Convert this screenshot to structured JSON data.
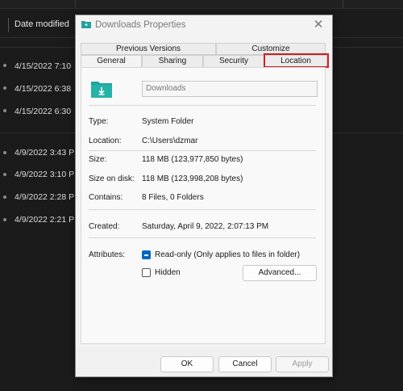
{
  "background": {
    "column_header": "Date modified",
    "rows": [
      "4/15/2022 7:10",
      "4/15/2022 6:38",
      "4/15/2022 6:30",
      "4/9/2022 3:43 P",
      "4/9/2022 3:10 P",
      "4/9/2022 2:28 P",
      "4/9/2022 2:21 P"
    ]
  },
  "dialog": {
    "title": "Downloads Properties",
    "close_glyph": "✕",
    "tabs_row1": [
      "Previous Versions",
      "Customize"
    ],
    "tabs_row2": [
      "General",
      "Sharing",
      "Security",
      "Location"
    ],
    "active_tab": "General",
    "highlighted_tab": "Location",
    "folder_name": "Downloads",
    "properties": [
      {
        "label": "Type:",
        "value": "System Folder"
      },
      {
        "label": "Location:",
        "value": "C:\\Users\\dzmar"
      },
      {
        "label": "Size:",
        "value": "118 MB (123,977,850 bytes)"
      },
      {
        "label": "Size on disk:",
        "value": "118 MB (123,998,208 bytes)"
      },
      {
        "label": "Contains:",
        "value": "8 Files, 0 Folders"
      },
      {
        "label": "Created:",
        "value": "Saturday, April 9, 2022, 2:07:13 PM"
      }
    ],
    "attributes": {
      "label": "Attributes:",
      "read_only": {
        "label": "Read-only (Only applies to files in folder)",
        "state": "indeterminate"
      },
      "hidden": {
        "label": "Hidden",
        "checked": false
      },
      "advanced_button": "Advanced..."
    },
    "buttons": {
      "ok": "OK",
      "cancel": "Cancel",
      "apply": "Apply"
    }
  },
  "colors": {
    "accent": "#0067c0",
    "highlight": "#d01f1f",
    "folder_icon": "#1fa39b"
  },
  "icons": {
    "title_icon": "folder-download-icon",
    "folder_icon": "folder-download-icon",
    "close_icon": "close-icon"
  }
}
